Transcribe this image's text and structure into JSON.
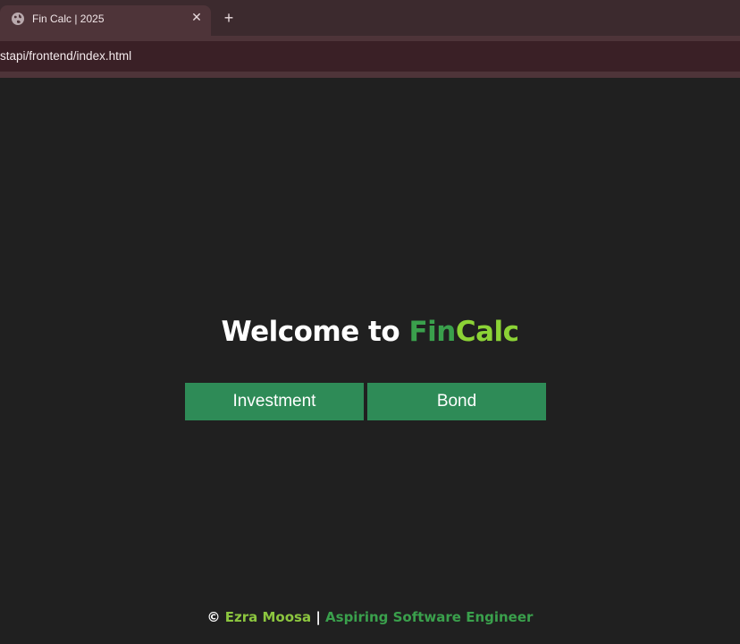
{
  "browser": {
    "tab": {
      "title": "Fin Calc | 2025",
      "favicon": "globe-icon",
      "close_glyph": "✕"
    },
    "new_tab_glyph": "+",
    "url": "stapi/frontend/index.html"
  },
  "main": {
    "welcome_prefix": "Welcome to ",
    "brand_part1": "Fin",
    "brand_part2": "Calc",
    "buttons": [
      {
        "label": "Investment"
      },
      {
        "label": "Bond"
      }
    ]
  },
  "footer": {
    "copyright": "© ",
    "name": "Ezra Moosa",
    "separator": " | ",
    "role": "Aspiring Software Engineer"
  },
  "colors": {
    "background": "#202020",
    "button": "#2e8b57",
    "brand_green": "#3aa04c",
    "brand_lime": "#8cd336"
  }
}
